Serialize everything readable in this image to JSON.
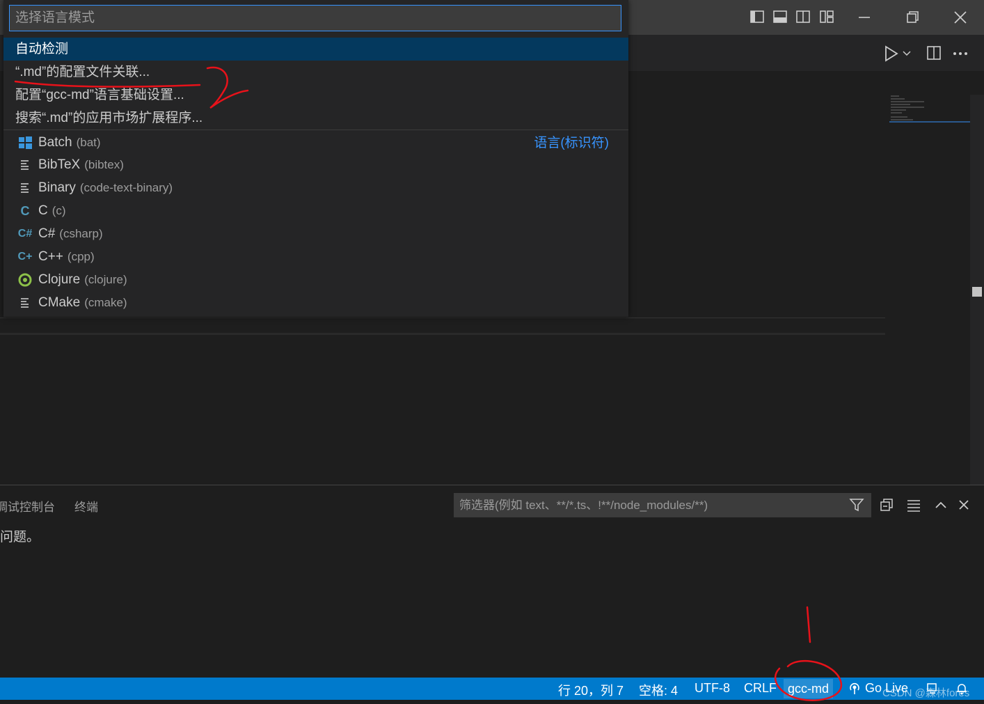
{
  "quick_pick": {
    "placeholder": "选择语言模式",
    "actions": [
      {
        "label": "自动检测"
      },
      {
        "label": "“.md”的配置文件关联..."
      },
      {
        "label": "配置“gcc-md”语言基础设置..."
      },
      {
        "label": "搜索“.md”的应用市场扩展程序..."
      }
    ],
    "group_label": "语言(标识符)",
    "languages": [
      {
        "name": "Batch",
        "id": "(bat)",
        "icon": "windows-icon"
      },
      {
        "name": "BibTeX",
        "id": "(bibtex)",
        "icon": "lines-icon"
      },
      {
        "name": "Binary",
        "id": "(code-text-binary)",
        "icon": "lines-icon"
      },
      {
        "name": "C",
        "id": "(c)",
        "icon": "c-icon"
      },
      {
        "name": "C#",
        "id": "(csharp)",
        "icon": "csharp-icon"
      },
      {
        "name": "C++",
        "id": "(cpp)",
        "icon": "cpp-icon"
      },
      {
        "name": "Clojure",
        "id": "(clojure)",
        "icon": "clojure-icon"
      },
      {
        "name": "CMake",
        "id": "(cmake)",
        "icon": "lines-icon"
      }
    ]
  },
  "panel": {
    "tabs": [
      "调试控制台",
      "终端"
    ],
    "filter_placeholder": "筛选器(例如 text、**/*.ts、!**/node_modules/**)",
    "message": "问题。"
  },
  "status_bar": {
    "position": "行 20，列 7",
    "spaces": "空格: 4",
    "encoding": "UTF-8",
    "eol": "CRLF",
    "language": "gcc-md",
    "golive": "Go Live"
  },
  "watermark": "CSDN @森林fores",
  "colors": {
    "status_bar": "#007acc",
    "selection": "#04395e",
    "accent_link": "#3794ff",
    "annotation": "#e8121a"
  }
}
